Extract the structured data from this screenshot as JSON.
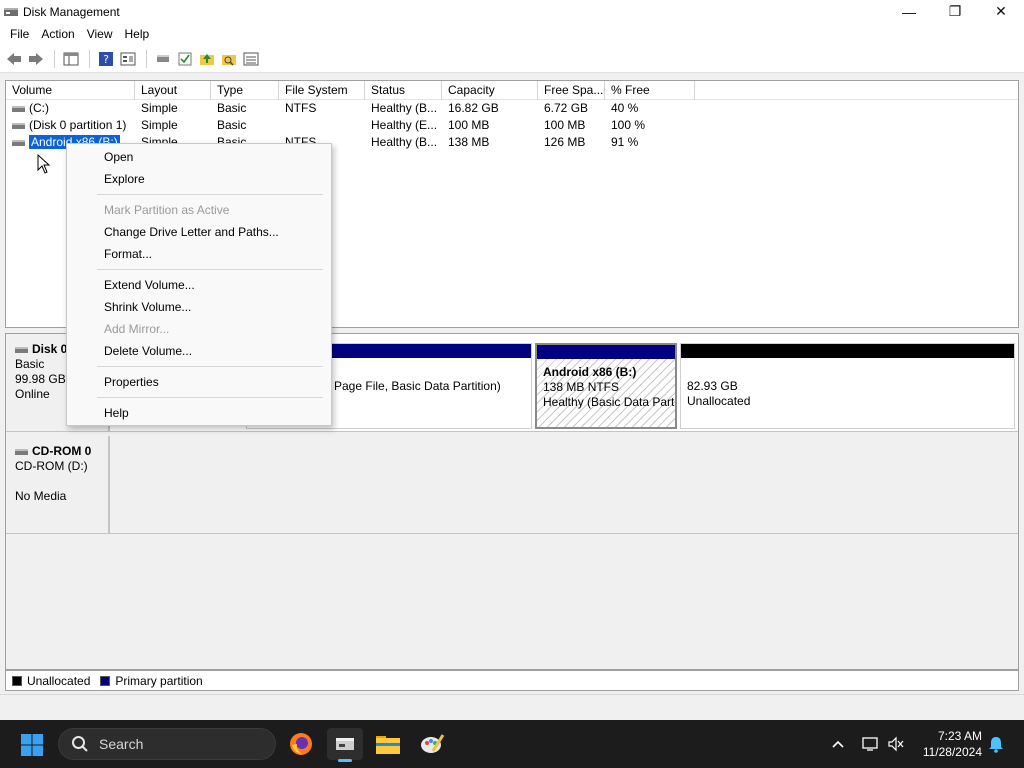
{
  "window": {
    "title": "Disk Management",
    "minimize": "—",
    "restore": "❐",
    "close": "✕"
  },
  "menu": [
    "File",
    "Action",
    "View",
    "Help"
  ],
  "toolbar_icons": [
    "back-icon",
    "forward-icon",
    "console-tree-icon",
    "help-icon",
    "properties-icon",
    "connect-icon",
    "check-icon",
    "folder-up-icon",
    "search-folder-icon",
    "list-view-icon"
  ],
  "volume_list": {
    "columns": [
      "Volume",
      "Layout",
      "Type",
      "File System",
      "Status",
      "Capacity",
      "Free Spa...",
      "% Free"
    ],
    "rows": [
      {
        "volume": "(C:)",
        "layout": "Simple",
        "type": "Basic",
        "fs": "NTFS",
        "status": "Healthy (B...",
        "capacity": "16.82 GB",
        "free": "6.72 GB",
        "pct": "40 %"
      },
      {
        "volume": "(Disk 0 partition 1)",
        "layout": "Simple",
        "type": "Basic",
        "fs": "",
        "status": "Healthy (E...",
        "capacity": "100 MB",
        "free": "100 MB",
        "pct": "100 %"
      },
      {
        "volume": "Android x86 (B:)",
        "layout": "Simple",
        "type": "Basic",
        "fs": "NTFS",
        "status": "Healthy (B...",
        "capacity": "138 MB",
        "free": "126 MB",
        "pct": "91 %"
      }
    ]
  },
  "disk0": {
    "name": "Disk 0",
    "type": "Basic",
    "size": "99.98 GB",
    "state": "Online",
    "c_partition_desc": "Page File, Basic Data Partition)",
    "android_label": "Android x86  (B:)",
    "android_size": "138 MB NTFS",
    "android_status": "Healthy (Basic Data Parti",
    "unalloc_size": "82.93 GB",
    "unalloc_label": "Unallocated"
  },
  "cdrom0": {
    "name": "CD-ROM 0",
    "type": "CD-ROM (D:)",
    "media": "No Media"
  },
  "legend": {
    "unallocated": "Unallocated",
    "primary": "Primary partition",
    "unallocated_color": "#000000",
    "primary_color": "#000080"
  },
  "context_menu": {
    "open": "Open",
    "explore": "Explore",
    "mark_active": "Mark Partition as Active",
    "change_letter": "Change Drive Letter and Paths...",
    "format": "Format...",
    "extend": "Extend Volume...",
    "shrink": "Shrink Volume...",
    "add_mirror": "Add Mirror...",
    "delete": "Delete Volume...",
    "properties": "Properties",
    "help": "Help"
  },
  "taskbar": {
    "search_placeholder": "Search",
    "time": "7:23 AM",
    "date": "11/28/2024"
  },
  "colors": {
    "selection": "#0a64d8",
    "partition_bar": "#000080",
    "accent": "#1a8cff"
  }
}
